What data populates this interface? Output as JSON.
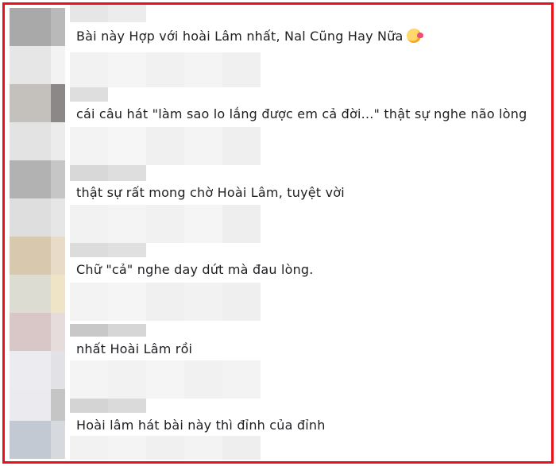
{
  "comments": [
    {
      "text": "Bài này Hợp với hoài Lâm nhất, Nal Cũng Hay Nữa",
      "emoji": "smiling-face-with-hearts-icon"
    },
    {
      "text": "cái câu hát \"làm sao lo lắng được em cả đời...\" thật sự nghe não lòng"
    },
    {
      "text": "thật sự rất mong chờ Hoài Lâm, tuyệt vời"
    },
    {
      "text": "Chữ \"cả\" nghe day dứt mà đau lòng."
    },
    {
      "text": "nhất Hoài Lâm rồi"
    },
    {
      "text": "Hoài lâm hát bài này thì đỉnh của đỉnh"
    }
  ],
  "colors": {
    "border": "#e8101a",
    "text": "#1c1e21"
  }
}
